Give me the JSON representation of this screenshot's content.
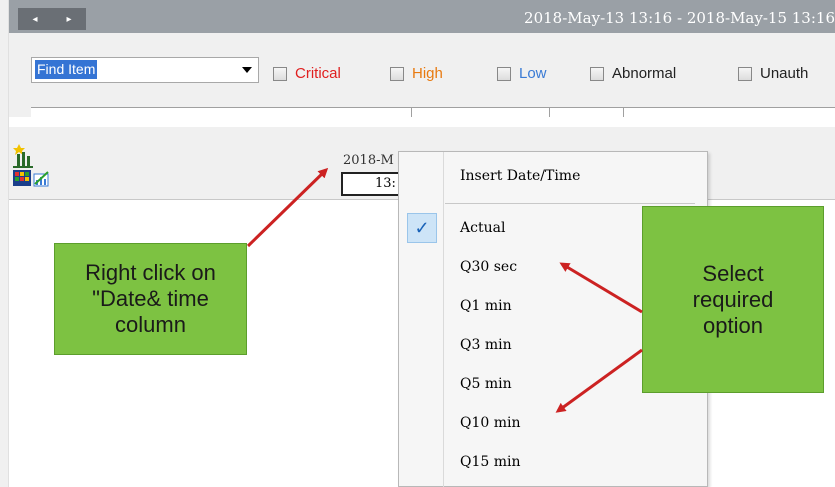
{
  "topbar": {
    "nav_left": "◂",
    "nav_right": "▸",
    "date_range": "2018-May-13 13:16 - 2018-May-15 13:16"
  },
  "filter": {
    "find_select_value": "Find Item",
    "checkboxes": [
      {
        "label": "Critical",
        "color": "#e02020"
      },
      {
        "label": "High",
        "color": "#e87a10"
      },
      {
        "label": "Low",
        "color": "#3a7bd5"
      },
      {
        "label": "Abnormal",
        "color": "#222222"
      },
      {
        "label": "Unauth",
        "color": "#222222"
      }
    ]
  },
  "grid": {
    "date_header_top": "2018-M",
    "date_header_time": "13:"
  },
  "context_menu": {
    "header": "Insert Date/Time",
    "items": [
      "Actual",
      "Q30 sec",
      "Q1 min",
      "Q3 min",
      "Q5 min",
      "Q10 min",
      "Q15 min"
    ],
    "checked_item": "Actual",
    "check_glyph": "✓"
  },
  "callouts": {
    "left": "Right click  on \"Date& time column",
    "right": "Select required option"
  },
  "colors": {
    "callout_green": "#7dc242",
    "arrow_red": "#cc2222",
    "topbar_gray": "#9aa0a6"
  }
}
